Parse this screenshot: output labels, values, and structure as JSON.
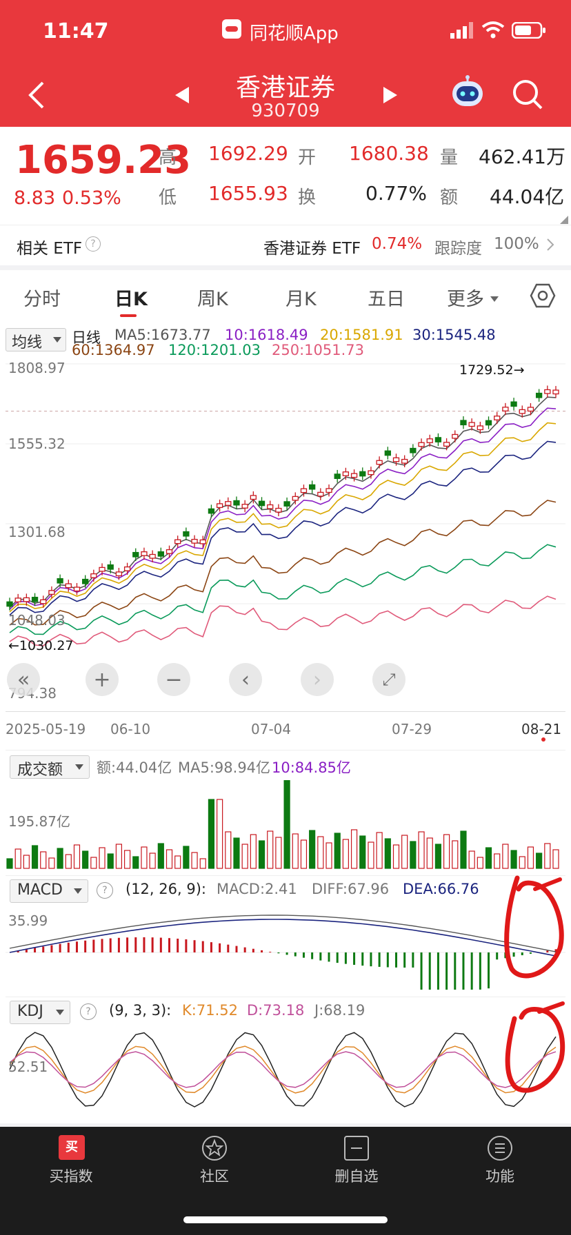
{
  "status": {
    "time": "11:47",
    "app_name": "同花顺App"
  },
  "header": {
    "title": "香港证券",
    "code": "930709"
  },
  "quote": {
    "price": "1659.23",
    "change": "8.83",
    "change_pct": "0.53%",
    "high_label": "高",
    "high": "1692.29",
    "low_label": "低",
    "low": "1655.93",
    "open_label": "开",
    "open": "1680.38",
    "turnover_label": "换",
    "turnover": "0.77%",
    "volume_label": "量",
    "volume": "462.41万",
    "amount_label": "额",
    "amount": "44.04亿"
  },
  "etf": {
    "label": "相关 ETF",
    "name": "香港证券 ETF",
    "pct": "0.74%",
    "tracking_label": "跟踪度",
    "tracking": "100%"
  },
  "tabs": [
    "分时",
    "日K",
    "周K",
    "月K",
    "五日",
    "更多"
  ],
  "kline": {
    "indicator_select": "均线",
    "line_label": "日线",
    "ma": [
      {
        "label": "MA5:1673.77",
        "color": "#555555"
      },
      {
        "label": "10:1618.49",
        "color": "#8a1fc4"
      },
      {
        "label": "20:1581.91",
        "color": "#d9a700"
      },
      {
        "label": "30:1545.48",
        "color": "#1a237e"
      },
      {
        "label": "60:1364.97",
        "color": "#8b4513"
      },
      {
        "label": "120:1201.03",
        "color": "#0a9a5a"
      },
      {
        "label": "250:1051.73",
        "color": "#e05a7a"
      }
    ],
    "y_ticks": [
      "1808.97",
      "1555.32",
      "1301.68",
      "1048.03",
      "794.38"
    ],
    "high_mark": "1729.52",
    "low_mark": "1030.27",
    "x_ticks": [
      "2025-05-19",
      "06-10",
      "07-04",
      "07-29",
      "08-21"
    ]
  },
  "volume": {
    "select": "成交额",
    "amount": "额:44.04亿",
    "ma5": "MA5:98.94亿",
    "ma10": "10:84.85亿",
    "y_tick": "195.87亿"
  },
  "macd": {
    "select": "MACD",
    "params": "(12, 26, 9):",
    "macd": "MACD:2.41",
    "diff": "DIFF:67.96",
    "dea": "DEA:66.76",
    "y_tick": "35.99"
  },
  "kdj": {
    "select": "KDJ",
    "params": "(9, 3, 3):",
    "k": "K:71.52",
    "d": "D:73.18",
    "j": "J:68.19",
    "y_tick": "52.51"
  },
  "bottom_nav": [
    "买指数",
    "社区",
    "删自选",
    "功能"
  ],
  "colors": {
    "brand_red": "#e8383d",
    "up": "#c8171e",
    "down": "#0d7a12"
  }
}
